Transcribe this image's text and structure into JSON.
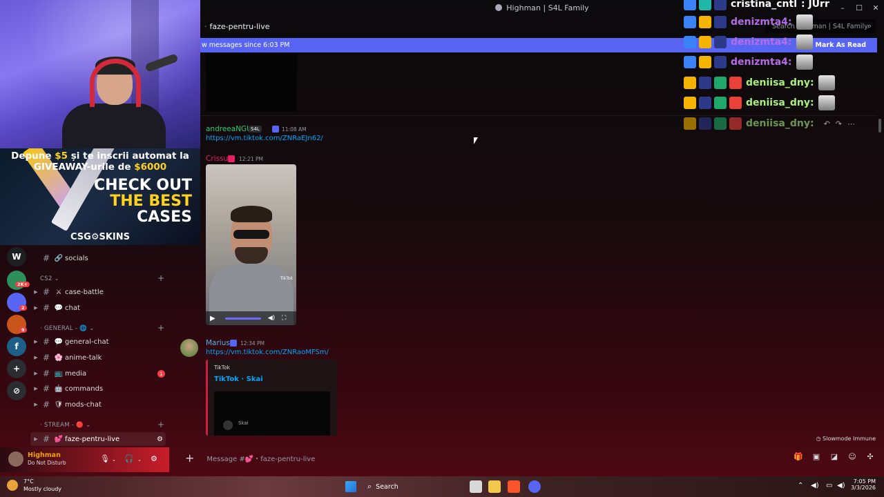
{
  "window": {
    "title": "Highman | S4L Family",
    "controls": [
      "–",
      "☐",
      "✕"
    ]
  },
  "channel": {
    "name": "faze-pentru-live",
    "search_placeholder": "Search Highman | S4L Family"
  },
  "new_messages_bar": {
    "text": "w messages since 6:03 PM",
    "mark_as_read": "Mark As Read"
  },
  "messages": [
    {
      "author": "andreeaNGU",
      "role": "S4L",
      "time": "11:08 AM",
      "link": "https://vm.tiktok.com/ZNRaEJn62/",
      "author_color": "#2ecc71"
    },
    {
      "author": "Crissu",
      "time": "12:21 PM",
      "attachment": "video",
      "video_logo": "TikTok",
      "author_color": "#e91e63"
    },
    {
      "author": "Marius",
      "time": "12:34 PM",
      "link": "https://vm.tiktok.com/ZNRaoMFSm/",
      "author_color": "#5dadec",
      "embed": {
        "provider": "TikTok",
        "title": "TikTok · Skai",
        "thumb_name": "Skai"
      }
    }
  ],
  "slowmode": "Slowmode Immune",
  "message_input": {
    "placeholder": "Message #💕・faze-pentru-live"
  },
  "webcam": {},
  "ad": {
    "line1_pre": "Depune ",
    "line1_amount": "$5",
    "line1_post": " și te inscrii automat la",
    "line2_pre": "GIVEAWAY-urile de ",
    "line2_amount": "$6000",
    "check_line1": "CHECK OUT",
    "check_line2": "THE BEST",
    "check_line3": "CASES",
    "brand": "CSG⚙SKINS"
  },
  "server_rail": {
    "items": [
      {
        "label": "W",
        "color": "#1e1f22"
      },
      {
        "label": "",
        "color": "#2d8f5a",
        "badge": "2K+"
      },
      {
        "label": "",
        "color": "#5865f2",
        "badge": "2"
      },
      {
        "label": "",
        "color": "#c9541c",
        "badge": "9"
      },
      {
        "label": "f",
        "color": "#1e5f8a"
      },
      {
        "label": "+",
        "color": "#2b2d31"
      },
      {
        "label": "⊘",
        "color": "#2b2d31"
      }
    ]
  },
  "channels": {
    "socials": {
      "name": "socials",
      "emoji": "🔗"
    },
    "cs2_category": "CS2",
    "case_battle": {
      "name": "case-battle",
      "emoji": "⚔"
    },
    "chat": {
      "name": "chat",
      "emoji": "💬"
    },
    "general_category": "GENERAL - 🌐",
    "general_chat": {
      "name": "general-chat",
      "emoji": "💬"
    },
    "anime_talk": {
      "name": "anime-talk",
      "emoji": "🌸"
    },
    "media": {
      "name": "media",
      "emoji": "📺",
      "unread": "1"
    },
    "commands": {
      "name": "commands",
      "emoji": "🤖"
    },
    "mods_chat": {
      "name": "mods-chat",
      "emoji": "🛡"
    },
    "stream_category": "STREAM - 🔴",
    "faze": {
      "name": "faze-pentru-live",
      "emoji": "💕"
    }
  },
  "user": {
    "name": "Highman",
    "status": "Do Not Disturb"
  },
  "taskbar": {
    "weather_temp": "7°C",
    "weather_cond": "Mostly cloudy",
    "search": "Search",
    "time": "7:05 PM",
    "date": "3/3/2026"
  },
  "overlay": {
    "rows": [
      {
        "name": "cristina_cntl",
        "suffix": ": JUrr",
        "color": "#ffffff"
      },
      {
        "name": "denizmta4:",
        "color": "#b56ce6"
      },
      {
        "name": "denizmta4:",
        "color": "#b56ce6"
      },
      {
        "name": "denizmta4:",
        "color": "#b56ce6"
      },
      {
        "name": "deniisa_dny:",
        "color": "#a8f07a"
      },
      {
        "name": "deniisa_dny:",
        "color": "#a8f07a"
      },
      {
        "name": "deniisa_dny:",
        "color": "#a8f07a"
      }
    ]
  }
}
